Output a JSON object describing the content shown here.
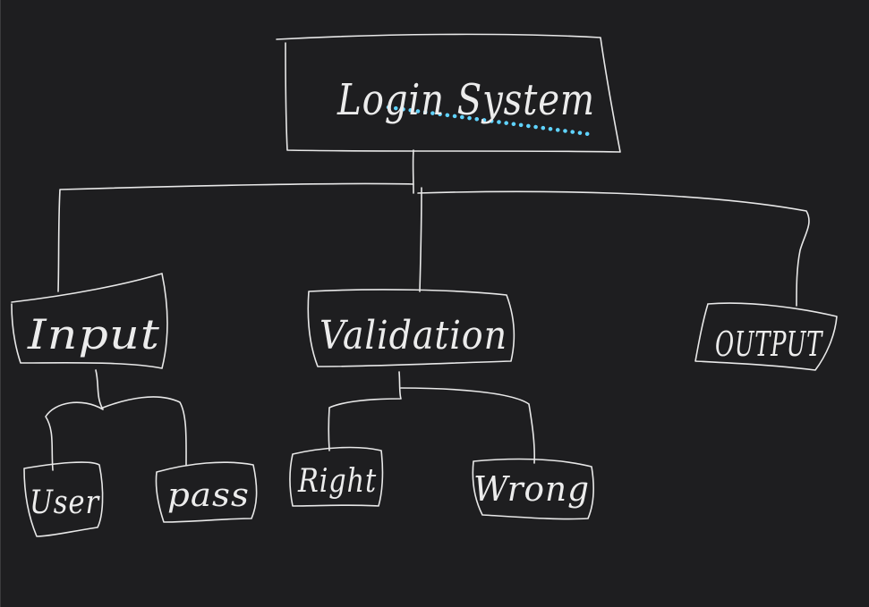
{
  "nodes": {
    "root": {
      "label": "Login System"
    },
    "input": {
      "label": "Input"
    },
    "validation": {
      "label": "Validation"
    },
    "output": {
      "label": "OUTPUT"
    },
    "user": {
      "label": "User"
    },
    "pass": {
      "label": "pass"
    },
    "right": {
      "label": "Right"
    },
    "wrong": {
      "label": "Wrong"
    }
  },
  "colors": {
    "background": "#1e1e20",
    "ink": "#e8e8e8",
    "highlight": "#5fd3ff"
  }
}
